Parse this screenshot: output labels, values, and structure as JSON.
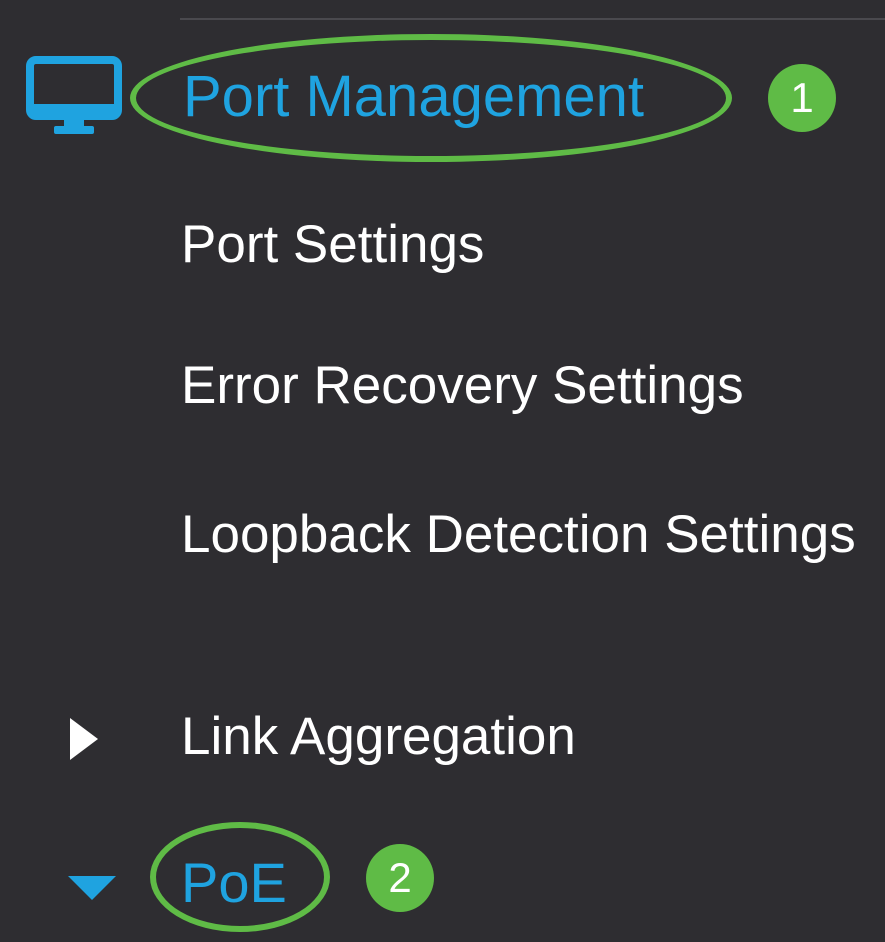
{
  "colors": {
    "background": "#2e2d31",
    "accent_blue": "#1fa3e0",
    "highlight_green": "#5fbb46",
    "text_white": "#ffffff"
  },
  "section": {
    "icon": "monitor-icon",
    "title": "Port Management",
    "step_badge": "1"
  },
  "menu": {
    "items": [
      {
        "label": "Port Settings"
      },
      {
        "label": "Error Recovery Settings"
      },
      {
        "label": "Loopback Detection Settings"
      },
      {
        "label": "Link Aggregation",
        "icon": "caret-right-icon",
        "expanded": false
      },
      {
        "label": "PoE",
        "icon": "caret-down-icon",
        "expanded": true,
        "step_badge": "2"
      }
    ]
  }
}
